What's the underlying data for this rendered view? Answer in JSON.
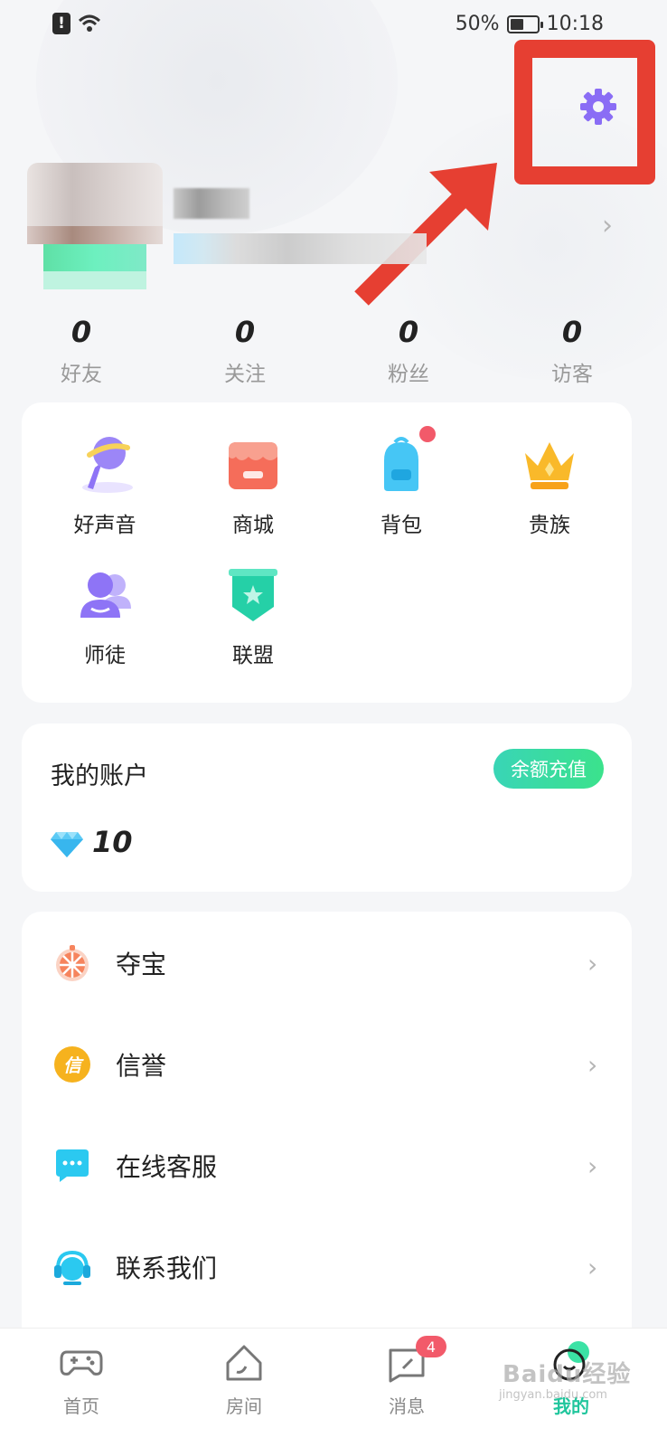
{
  "status_bar": {
    "battery": "50%",
    "time": "10:18",
    "battery_level": 0.5
  },
  "stats": [
    {
      "value": "0",
      "label": "好友"
    },
    {
      "value": "0",
      "label": "关注"
    },
    {
      "value": "0",
      "label": "粉丝"
    },
    {
      "value": "0",
      "label": "访客"
    }
  ],
  "features": [
    {
      "label": "好声音",
      "icon": "microphone-icon"
    },
    {
      "label": "商城",
      "icon": "shop-icon"
    },
    {
      "label": "背包",
      "icon": "backpack-icon"
    },
    {
      "label": "贵族",
      "icon": "crown-icon"
    },
    {
      "label": "师徒",
      "icon": "mentor-icon"
    },
    {
      "label": "联盟",
      "icon": "alliance-badge-icon"
    }
  ],
  "account": {
    "title": "我的账户",
    "recharge_label": "余额充值",
    "balance": "10"
  },
  "menu": [
    {
      "label": "夺宝",
      "icon": "treasure-wheel-icon"
    },
    {
      "label": "信誉",
      "icon": "credit-icon",
      "icon_text": "信"
    },
    {
      "label": "在线客服",
      "icon": "chat-bubble-icon"
    },
    {
      "label": "联系我们",
      "icon": "headset-icon"
    }
  ],
  "bottom_nav": [
    {
      "label": "首页",
      "icon": "gamepad-icon"
    },
    {
      "label": "房间",
      "icon": "house-icon"
    },
    {
      "label": "消息",
      "icon": "message-icon",
      "badge": "4"
    },
    {
      "label": "我的",
      "icon": "profile-icon",
      "active": true
    }
  ],
  "watermark": {
    "text": "Baidu经验",
    "sub": "jingyan.baidu.com"
  },
  "colors": {
    "accent": "#21c69d",
    "highlight": "#e63f32",
    "gear": "#8a6df5"
  }
}
